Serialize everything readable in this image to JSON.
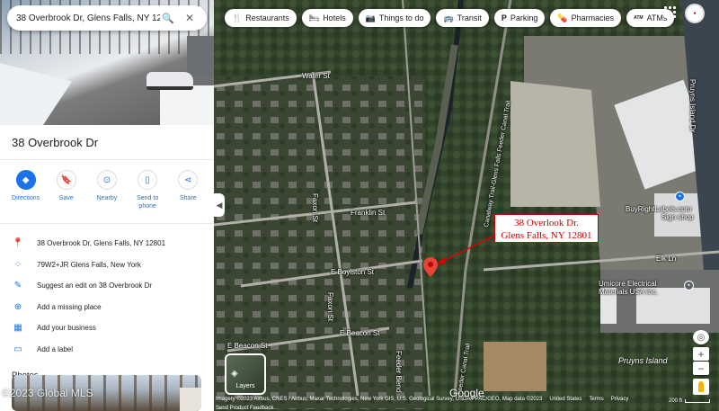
{
  "search": {
    "value": "38 Overbrook Dr, Glens Falls, NY 12801"
  },
  "place": {
    "title": "38 Overbrook Dr"
  },
  "actions": [
    {
      "label": "Directions"
    },
    {
      "label": "Save"
    },
    {
      "label": "Nearby"
    },
    {
      "label": "Send to phone"
    },
    {
      "label": "Share"
    }
  ],
  "info": [
    {
      "icon": "location-pin-icon",
      "text": "38 Overbrook Dr, Glens Falls, NY 12801"
    },
    {
      "icon": "plus-code-icon",
      "text": "79W2+JR Glens Falls, New York"
    },
    {
      "icon": "pencil-icon",
      "text": "Suggest an edit on 38 Overbrook Dr"
    },
    {
      "icon": "add-location-icon",
      "text": "Add a missing place"
    },
    {
      "icon": "add-business-icon",
      "text": "Add your business"
    },
    {
      "icon": "label-icon",
      "text": "Add a label"
    }
  ],
  "photos": {
    "heading": "Photos",
    "watermark": "©2023 Global MLS"
  },
  "chips": [
    {
      "icon": "fork-knife-icon",
      "label": "Restaurants"
    },
    {
      "icon": "bed-icon",
      "label": "Hotels"
    },
    {
      "icon": "camera-icon",
      "label": "Things to do"
    },
    {
      "icon": "bus-icon",
      "label": "Transit"
    },
    {
      "icon": "parking-icon",
      "label": "Parking"
    },
    {
      "icon": "pill-icon",
      "label": "Pharmacies"
    },
    {
      "icon": "atm-icon",
      "label": "ATMs"
    }
  ],
  "callout": {
    "line1": "38 Overlook Dr.",
    "line2": "Glens Falls, NY 12801"
  },
  "streets": {
    "water": "Water St",
    "franklin": "Franklin St",
    "boylston": "E Boylston St",
    "beacon_e": "E Beacon St",
    "beacon": "E Beacon St",
    "faxon1": "Faxon St",
    "faxon2": "Faxon St",
    "feeder": "Feeder Bend",
    "canal1": "Canalway Trail-Glens Falls Feeder Canal Trail",
    "canal2": "Feeder Canal Trail",
    "elk": "Elk Ln",
    "pruyns": "Pruyns Island Dr"
  },
  "pois": {
    "buyright": "BuyRightLabels.com",
    "buyright_sub": "Sign shop",
    "umicore1": "Umicore Electrical",
    "umicore2": "Materials USA Inc.",
    "island": "Pruyns Island"
  },
  "layers": {
    "label": "Layers"
  },
  "google": {
    "logo": "Google"
  },
  "attribution": {
    "imagery": "Imagery ©2023 Airbus, CNES / Airbus, Maxar Technologies, New York GIS, U.S. Geological Survey, USDA/FPAC/GEO, Map data ©2023",
    "country": "United States",
    "terms": "Terms",
    "privacy": "Privacy",
    "feedback": "Send Product Feedback",
    "scale": "200 ft"
  }
}
